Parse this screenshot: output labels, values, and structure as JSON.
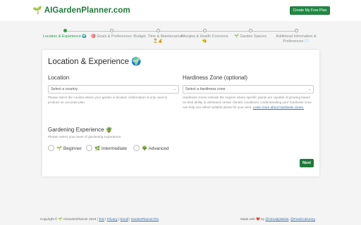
{
  "header": {
    "brand_icon": "🌱",
    "brand_name": "AIGardenPlanner.com",
    "cta_label": "Create My Free Plan"
  },
  "stepper": {
    "steps": [
      {
        "label": "Location & Experience 🌍",
        "state": "current"
      },
      {
        "label": "🎯 Goals & Preferences",
        "state": "upcoming"
      },
      {
        "label": "Budget, Time & Maintenance ⏳💰",
        "state": "upcoming"
      },
      {
        "label": "Allergies & Health Concerns 🤧",
        "state": "upcoming"
      },
      {
        "label": "🌱 Garden Spaces",
        "state": "upcoming"
      },
      {
        "label": "Additional Information & Preferences 📨",
        "state": "upcoming"
      }
    ]
  },
  "card": {
    "title": "Location & Experience 🌍",
    "location": {
      "label": "Location",
      "select_value": "Select a country",
      "help": "Please select the country where your garden is located. (Information is only used to produce an accurate plan."
    },
    "hardiness": {
      "label": "Hardiness Zone (optional)",
      "select_value": "Select a hardiness zone",
      "help": "Hardiness zones indicate the regions where specific plants are capable of growing based on their ability to withstand certain climatic conditions. Understanding your hardiness zone can help you select suitable plants for your area.",
      "link_text": "Learn more about hardiness zones."
    },
    "experience": {
      "title": "Gardening Experience 🪴",
      "help": "Please select your level of gardening experience.",
      "options": [
        {
          "label": "🌱 Beginner"
        },
        {
          "label": "🌿 Intermediate"
        },
        {
          "label": "🌳 Advanced"
        }
      ]
    },
    "next_label": "Next"
  },
  "footer": {
    "copyright": "Copyright © 🌱 AIGardenPlanner 2023 | ",
    "links": [
      "ToS",
      "Privacy",
      "Email",
      "GardenPlanner.Pro"
    ],
    "made_with": "Made with ",
    "heart": "❤️",
    "by": " by ",
    "authors": [
      "@AlreadyWeide",
      "@FrankCdeJong"
    ]
  }
}
